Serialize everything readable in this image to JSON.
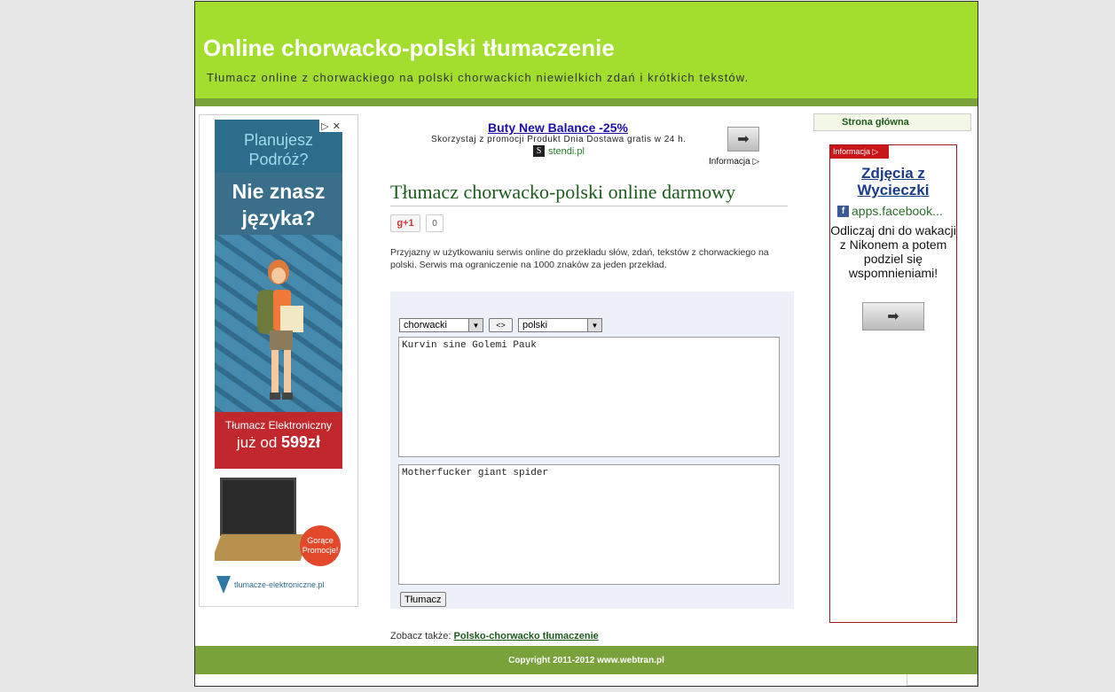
{
  "header": {
    "title": "Online chorwacko-polski tłumaczenie",
    "subtitle": "Tłumacz online z chorwackiego na polski chorwackich niewielkich zdań i krótkich tekstów."
  },
  "left_ad": {
    "line1": "Planujesz Podróż?",
    "line2": "Nie znasz języka?",
    "red1": "Tłumacz Elektroniczny",
    "red2_prefix": "już od ",
    "red2_price": "599zł",
    "promo": "Gorące Promocje!",
    "logo": "tlumacze-elektroniczne.pl"
  },
  "text_ad": {
    "headline": "Buty New Balance -25%",
    "description": "Skorzystaj z promocji Produkt Dnia Dostawa gratis w 24 h.",
    "source": "stendi.pl",
    "source_icon": "S",
    "info": "Informacja ▷"
  },
  "main": {
    "heading": "Tłumacz chorwacko-polski online darmowy",
    "gplus_label": "+1",
    "gplus_count": "0",
    "intro": "Przyjazny w użytkowaniu serwis online do przekładu słów, zdań, tekstów z chorwackiego na polski. Serwis ma ograniczenie na 1000 znaków za jeden przekład."
  },
  "translator": {
    "source_lang": "chorwacki",
    "target_lang": "polski",
    "swap_label": "<>",
    "source_text": "Kurvin sine Golemi Pauk",
    "target_text": "Motherfucker giant spider",
    "translate_label": "Tłumacz"
  },
  "see_also": {
    "label": "Zobacz także: ",
    "link": "Polsko-chorwacko tłumaczenie"
  },
  "nav": {
    "home": "Strona główna"
  },
  "right_ad": {
    "badge": "Informacja ▷",
    "title": "Zdjęcia z Wycieczki",
    "source": "apps.facebook...",
    "description": "Odliczaj dni do wakacji z Nikonem a potem podziel się wspomnieniami!"
  },
  "footer": {
    "copyright": "Copyright 2011-2012 www.webtran.pl"
  }
}
